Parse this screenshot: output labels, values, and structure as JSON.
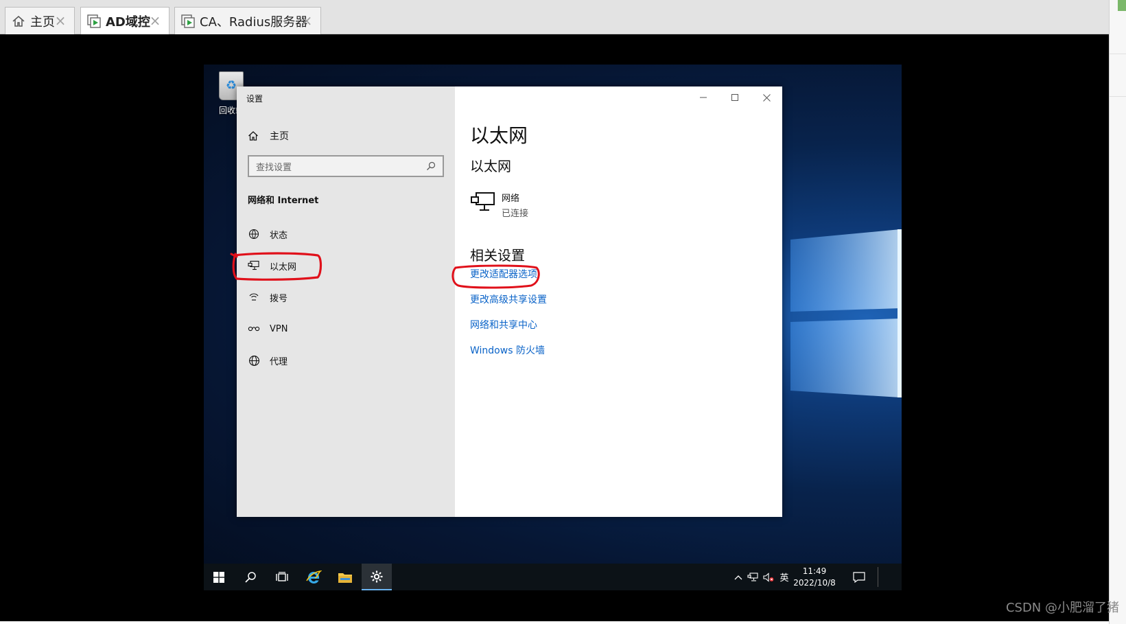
{
  "tabs": [
    {
      "label": "主页",
      "icon": "home-icon"
    },
    {
      "label": "AD域控",
      "icon": "vm-icon",
      "active": true
    },
    {
      "label": "CA、Radius服务器",
      "icon": "vm-icon"
    }
  ],
  "desktop": {
    "recycle_bin_label": "回收站"
  },
  "settings": {
    "window_title": "设置",
    "home_label": "主页",
    "search_placeholder": "查找设置",
    "section_label": "网络和 Internet",
    "nav_items": [
      {
        "label": "状态",
        "icon": "globe-status-icon"
      },
      {
        "label": "以太网",
        "icon": "ethernet-icon",
        "selected": true
      },
      {
        "label": "拨号",
        "icon": "dialup-icon"
      },
      {
        "label": "VPN",
        "icon": "vpn-icon"
      },
      {
        "label": "代理",
        "icon": "globe-icon"
      }
    ],
    "content": {
      "page_title": "以太网",
      "subtitle": "以太网",
      "network_name": "网络",
      "network_status": "已连接",
      "related_title": "相关设置",
      "links": [
        "更改适配器选项",
        "更改高级共享设置",
        "网络和共享中心",
        "Windows 防火墙"
      ]
    }
  },
  "taskbar": {
    "tray_ime": "英",
    "time": "11:49",
    "date": "2022/10/8"
  },
  "watermark": "CSDN @小肥溜了猪",
  "colors": {
    "link": "#0a63c8",
    "annotation": "#e0101a",
    "nav_bg": "#e6e6e6"
  }
}
